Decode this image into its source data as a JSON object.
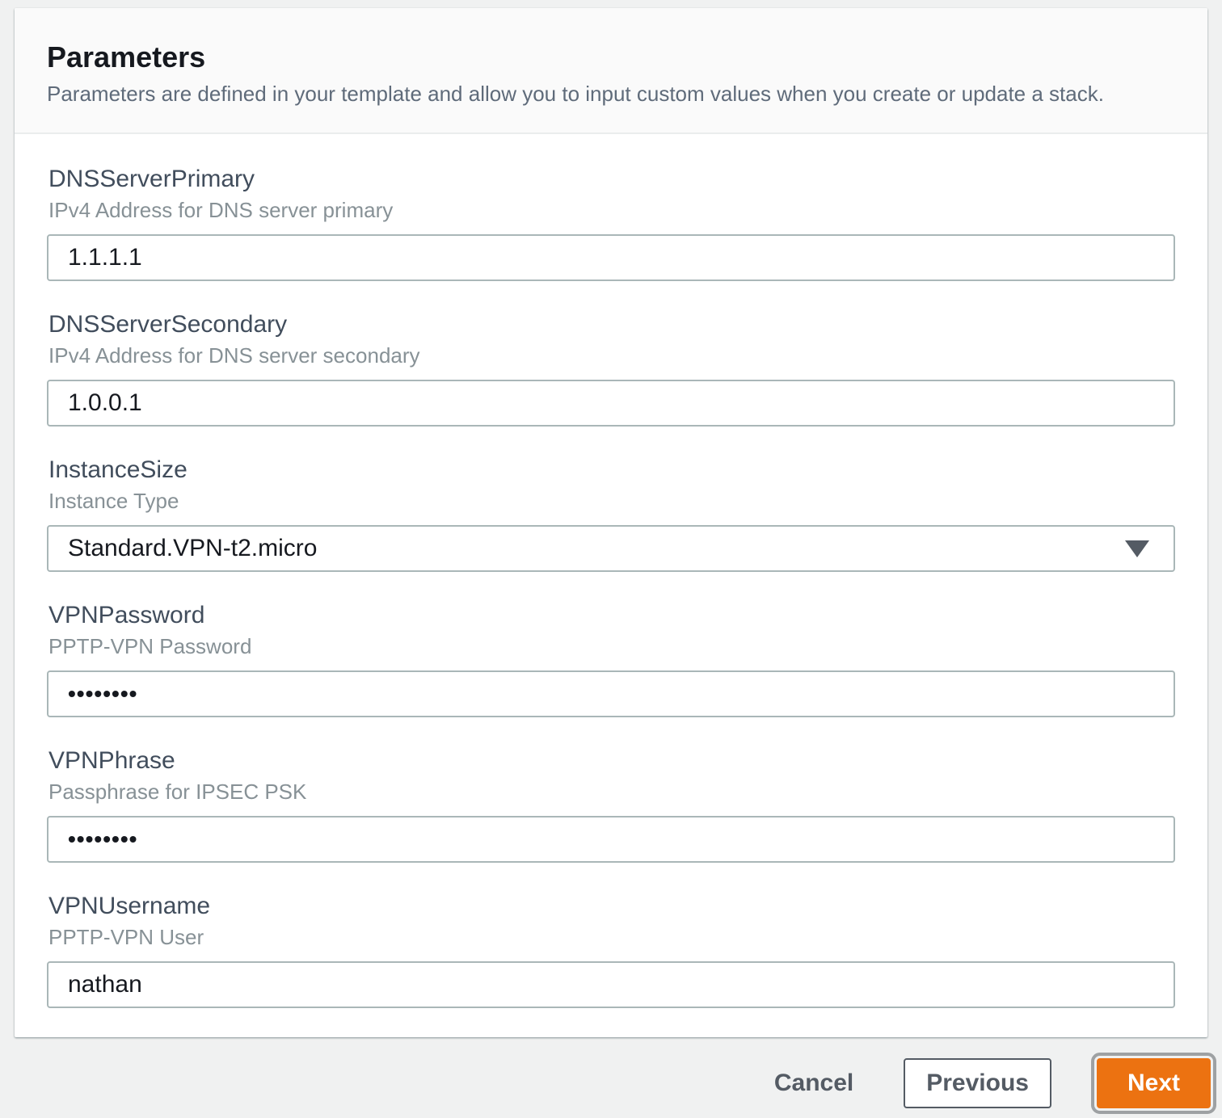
{
  "panel": {
    "title": "Parameters",
    "description": "Parameters are defined in your template and allow you to input custom values when you create or update a stack."
  },
  "fields": [
    {
      "label": "DNSServerPrimary",
      "description": "IPv4 Address for DNS server primary",
      "value": "1.1.1.1",
      "type": "text"
    },
    {
      "label": "DNSServerSecondary",
      "description": "IPv4 Address for DNS server secondary",
      "value": "1.0.0.1",
      "type": "text"
    },
    {
      "label": "InstanceSize",
      "description": "Instance Type",
      "value": "Standard.VPN-t2.micro",
      "type": "select",
      "icon": "dropdown-caret-icon"
    },
    {
      "label": "VPNPassword",
      "description": "PPTP-VPN Password",
      "value": "••••••••",
      "type": "password"
    },
    {
      "label": "VPNPhrase",
      "description": "Passphrase for IPSEC PSK",
      "value": "••••••••",
      "type": "password"
    },
    {
      "label": "VPNUsername",
      "description": "PPTP-VPN User",
      "value": "nathan",
      "type": "text"
    }
  ],
  "actions": {
    "cancel": "Cancel",
    "previous": "Previous",
    "next": "Next"
  },
  "colors": {
    "page_background": "#f0f1f1",
    "panel_header_background": "#fafafa",
    "divider": "#eaeded",
    "title_text": "#16191f",
    "label_text": "#414d5c",
    "description_text": "#879196",
    "input_border": "#aab7b8",
    "button_secondary": "#545b64",
    "primary_accent": "#ec7211",
    "focus_ring": "#9ea1a3"
  }
}
